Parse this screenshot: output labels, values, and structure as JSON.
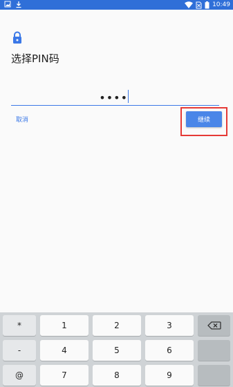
{
  "statusbar": {
    "time": "10:49"
  },
  "title": "选择PIN码",
  "pin": {
    "masked": "••••"
  },
  "actions": {
    "cancel": "取消",
    "continue": "继续"
  },
  "keyboard": {
    "rows": [
      [
        "*",
        "1",
        "2",
        "3"
      ],
      [
        "-",
        "4",
        "5",
        "6"
      ],
      [
        "@",
        "7",
        "8",
        "9"
      ]
    ]
  },
  "colors": {
    "accent": "#4a86e8",
    "statusbar": "#2f6fd8",
    "highlight": "#e53935"
  }
}
